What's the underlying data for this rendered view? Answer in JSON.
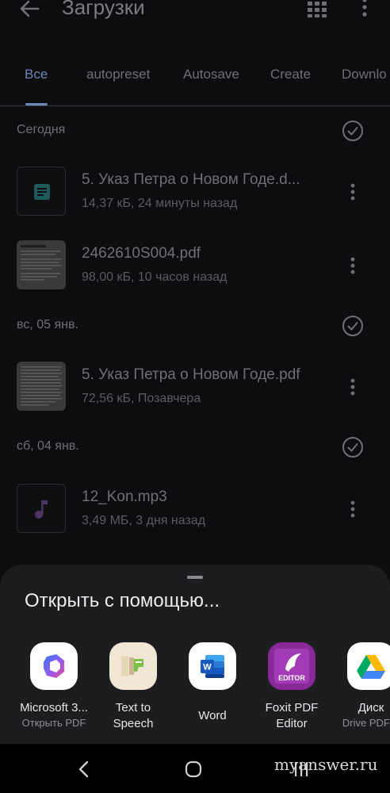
{
  "appbar": {
    "title": "Загрузки"
  },
  "tabs": [
    {
      "label": "Все"
    },
    {
      "label": "autopreset"
    },
    {
      "label": "Autosave"
    },
    {
      "label": "Create"
    },
    {
      "label": "Downlo"
    }
  ],
  "sections": [
    {
      "label": "Сегодня",
      "files": [
        {
          "name": "5. Указ Петра о Новом Годе.d...",
          "meta": "14,37 кБ, 24 минуты назад",
          "icon": "document-icon"
        },
        {
          "name": "2462610S004.pdf",
          "meta": "98,00 кБ, 10 часов назад",
          "icon": "pdf-thumbnail"
        }
      ]
    },
    {
      "label": "вс, 05 янв.",
      "files": [
        {
          "name": "5. Указ Петра о Новом Годе.pdf",
          "meta": "72,56 кБ, Позавчера",
          "icon": "pdf-thumbnail"
        }
      ]
    },
    {
      "label": "сб, 04 янв.",
      "files": [
        {
          "name": "12_Kon.mp3",
          "meta": "3,49 МБ, 3 дня назад",
          "icon": "music-note-icon"
        }
      ]
    }
  ],
  "sheet": {
    "title": "Открыть с помощью...",
    "apps": [
      {
        "name": "Microsoft 3...",
        "sub": "Открыть PDF"
      },
      {
        "name": "Text to",
        "sub": "Speech"
      },
      {
        "name": "Word",
        "sub": ""
      },
      {
        "name": "Foxit PDF",
        "sub": "Editor"
      },
      {
        "name": "Диск",
        "sub": "Drive PDF V"
      }
    ]
  },
  "foxit_badge": "EDITOR",
  "word_badge": "W",
  "watermark": "myanswer.ru",
  "colors": {
    "accent_tab": "#6e86b5",
    "sheet_bg": "#1d1d20",
    "background": "#0d0d0f"
  }
}
